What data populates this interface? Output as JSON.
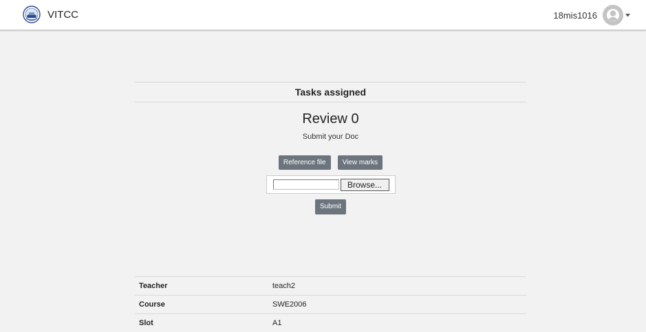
{
  "navbar": {
    "brand": "VITCC",
    "username": "18mis1016"
  },
  "card": {
    "header": "Tasks assigned",
    "title": "Review 0",
    "subtitle": "Submit your Doc",
    "reference_button": "Reference file",
    "marks_button": "View marks",
    "browse_button": "Browse...",
    "submit_button": "Submit"
  },
  "info": {
    "rows": [
      {
        "label": "Teacher",
        "value": "teach2"
      },
      {
        "label": "Course",
        "value": "SWE2006"
      },
      {
        "label": "Slot",
        "value": "A1"
      }
    ]
  }
}
